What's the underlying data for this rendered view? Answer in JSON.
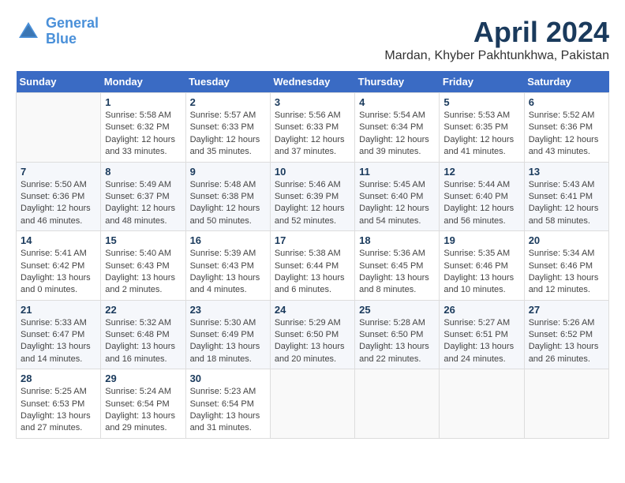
{
  "header": {
    "logo_line1": "General",
    "logo_line2": "Blue",
    "title": "April 2024",
    "location": "Mardan, Khyber Pakhtunkhwa, Pakistan"
  },
  "days_of_week": [
    "Sunday",
    "Monday",
    "Tuesday",
    "Wednesday",
    "Thursday",
    "Friday",
    "Saturday"
  ],
  "weeks": [
    [
      {
        "day": "",
        "info": ""
      },
      {
        "day": "1",
        "info": "Sunrise: 5:58 AM\nSunset: 6:32 PM\nDaylight: 12 hours\nand 33 minutes."
      },
      {
        "day": "2",
        "info": "Sunrise: 5:57 AM\nSunset: 6:33 PM\nDaylight: 12 hours\nand 35 minutes."
      },
      {
        "day": "3",
        "info": "Sunrise: 5:56 AM\nSunset: 6:33 PM\nDaylight: 12 hours\nand 37 minutes."
      },
      {
        "day": "4",
        "info": "Sunrise: 5:54 AM\nSunset: 6:34 PM\nDaylight: 12 hours\nand 39 minutes."
      },
      {
        "day": "5",
        "info": "Sunrise: 5:53 AM\nSunset: 6:35 PM\nDaylight: 12 hours\nand 41 minutes."
      },
      {
        "day": "6",
        "info": "Sunrise: 5:52 AM\nSunset: 6:36 PM\nDaylight: 12 hours\nand 43 minutes."
      }
    ],
    [
      {
        "day": "7",
        "info": "Sunrise: 5:50 AM\nSunset: 6:36 PM\nDaylight: 12 hours\nand 46 minutes."
      },
      {
        "day": "8",
        "info": "Sunrise: 5:49 AM\nSunset: 6:37 PM\nDaylight: 12 hours\nand 48 minutes."
      },
      {
        "day": "9",
        "info": "Sunrise: 5:48 AM\nSunset: 6:38 PM\nDaylight: 12 hours\nand 50 minutes."
      },
      {
        "day": "10",
        "info": "Sunrise: 5:46 AM\nSunset: 6:39 PM\nDaylight: 12 hours\nand 52 minutes."
      },
      {
        "day": "11",
        "info": "Sunrise: 5:45 AM\nSunset: 6:40 PM\nDaylight: 12 hours\nand 54 minutes."
      },
      {
        "day": "12",
        "info": "Sunrise: 5:44 AM\nSunset: 6:40 PM\nDaylight: 12 hours\nand 56 minutes."
      },
      {
        "day": "13",
        "info": "Sunrise: 5:43 AM\nSunset: 6:41 PM\nDaylight: 12 hours\nand 58 minutes."
      }
    ],
    [
      {
        "day": "14",
        "info": "Sunrise: 5:41 AM\nSunset: 6:42 PM\nDaylight: 13 hours\nand 0 minutes."
      },
      {
        "day": "15",
        "info": "Sunrise: 5:40 AM\nSunset: 6:43 PM\nDaylight: 13 hours\nand 2 minutes."
      },
      {
        "day": "16",
        "info": "Sunrise: 5:39 AM\nSunset: 6:43 PM\nDaylight: 13 hours\nand 4 minutes."
      },
      {
        "day": "17",
        "info": "Sunrise: 5:38 AM\nSunset: 6:44 PM\nDaylight: 13 hours\nand 6 minutes."
      },
      {
        "day": "18",
        "info": "Sunrise: 5:36 AM\nSunset: 6:45 PM\nDaylight: 13 hours\nand 8 minutes."
      },
      {
        "day": "19",
        "info": "Sunrise: 5:35 AM\nSunset: 6:46 PM\nDaylight: 13 hours\nand 10 minutes."
      },
      {
        "day": "20",
        "info": "Sunrise: 5:34 AM\nSunset: 6:46 PM\nDaylight: 13 hours\nand 12 minutes."
      }
    ],
    [
      {
        "day": "21",
        "info": "Sunrise: 5:33 AM\nSunset: 6:47 PM\nDaylight: 13 hours\nand 14 minutes."
      },
      {
        "day": "22",
        "info": "Sunrise: 5:32 AM\nSunset: 6:48 PM\nDaylight: 13 hours\nand 16 minutes."
      },
      {
        "day": "23",
        "info": "Sunrise: 5:30 AM\nSunset: 6:49 PM\nDaylight: 13 hours\nand 18 minutes."
      },
      {
        "day": "24",
        "info": "Sunrise: 5:29 AM\nSunset: 6:50 PM\nDaylight: 13 hours\nand 20 minutes."
      },
      {
        "day": "25",
        "info": "Sunrise: 5:28 AM\nSunset: 6:50 PM\nDaylight: 13 hours\nand 22 minutes."
      },
      {
        "day": "26",
        "info": "Sunrise: 5:27 AM\nSunset: 6:51 PM\nDaylight: 13 hours\nand 24 minutes."
      },
      {
        "day": "27",
        "info": "Sunrise: 5:26 AM\nSunset: 6:52 PM\nDaylight: 13 hours\nand 26 minutes."
      }
    ],
    [
      {
        "day": "28",
        "info": "Sunrise: 5:25 AM\nSunset: 6:53 PM\nDaylight: 13 hours\nand 27 minutes."
      },
      {
        "day": "29",
        "info": "Sunrise: 5:24 AM\nSunset: 6:54 PM\nDaylight: 13 hours\nand 29 minutes."
      },
      {
        "day": "30",
        "info": "Sunrise: 5:23 AM\nSunset: 6:54 PM\nDaylight: 13 hours\nand 31 minutes."
      },
      {
        "day": "",
        "info": ""
      },
      {
        "day": "",
        "info": ""
      },
      {
        "day": "",
        "info": ""
      },
      {
        "day": "",
        "info": ""
      }
    ]
  ]
}
